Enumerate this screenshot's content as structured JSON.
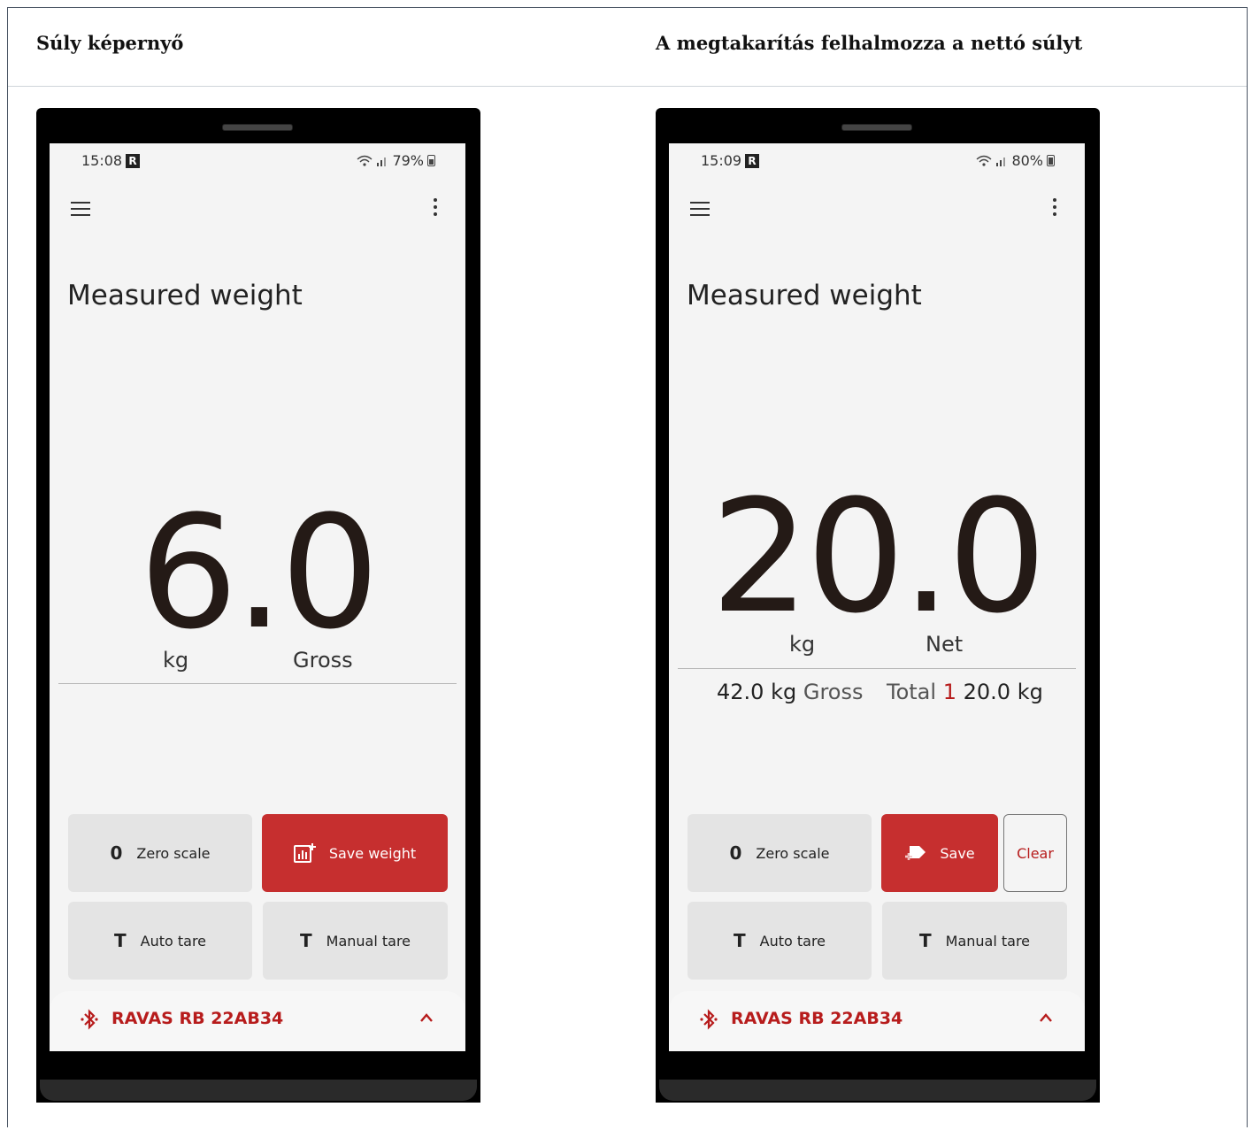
{
  "headers": {
    "left": "Súly képernyő",
    "right": "A megtakarítás felhalmozza a nettó súlyt"
  },
  "phone_left": {
    "status": {
      "time": "15:08",
      "badge": "R",
      "battery": "79%"
    },
    "title": "Measured weight",
    "weight": "6.0",
    "unit": "kg",
    "mode": "Gross",
    "buttons": {
      "zero_glyph": "0",
      "zero": "Zero scale",
      "save": "Save weight",
      "auto_glyph": "T",
      "auto": "Auto tare",
      "manual_glyph": "T",
      "manual": "Manual tare"
    },
    "device": "RAVAS RB 22AB34"
  },
  "phone_right": {
    "status": {
      "time": "15:09",
      "badge": "R",
      "battery": "80%"
    },
    "title": "Measured weight",
    "weight": "20.0",
    "unit": "kg",
    "mode": "Net",
    "summary": {
      "gross_value": "42.0 kg",
      "gross_label": "Gross",
      "total_label": "Total",
      "total_count": "1",
      "total_value": "20.0 kg"
    },
    "buttons": {
      "zero_glyph": "0",
      "zero": "Zero scale",
      "save": "Save",
      "clear": "Clear",
      "auto_glyph": "T",
      "auto": "Auto tare",
      "manual_glyph": "T",
      "manual": "Manual tare"
    },
    "device": "RAVAS RB 22AB34"
  },
  "colors": {
    "accent": "#c62f2f",
    "device_text": "#b71c1c",
    "weight_text": "#241a16"
  }
}
